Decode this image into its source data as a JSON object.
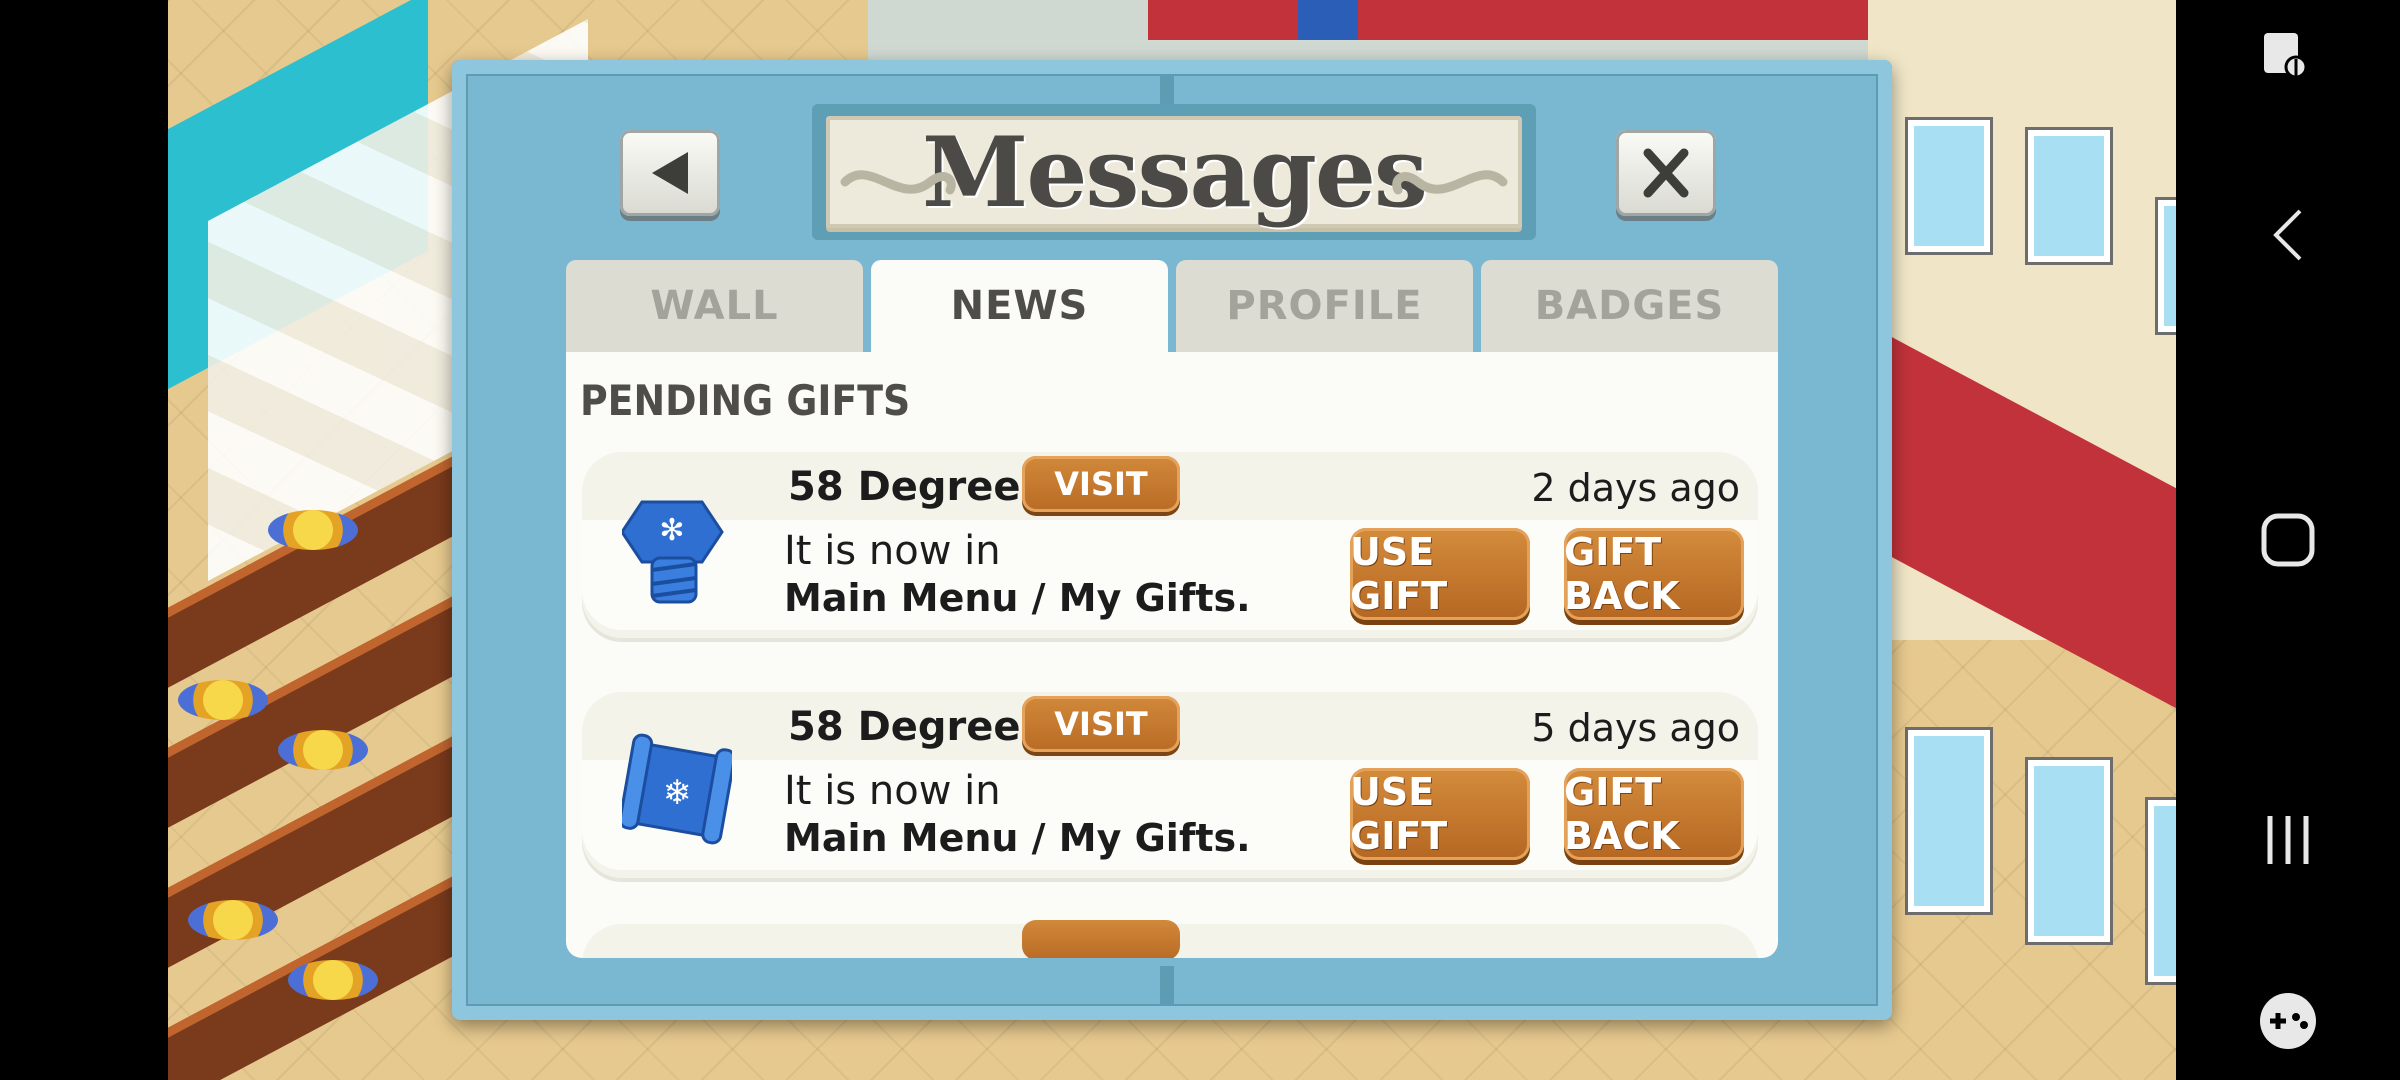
{
  "dialog": {
    "title": "Messages",
    "tabs": [
      {
        "label": "WALL",
        "active": false
      },
      {
        "label": "NEWS",
        "active": true
      },
      {
        "label": "PROFILE",
        "active": false
      },
      {
        "label": "BADGES",
        "active": false
      }
    ],
    "section_title": "PENDING GIFTS",
    "gifts": [
      {
        "sender": "58 Degrees",
        "visit_label": "VISIT",
        "time": "2 days ago",
        "message_line1": "It is now in",
        "message_line2": "Main Menu / My Gifts.",
        "use_label": "USE GIFT",
        "back_label": "GIFT BACK",
        "icon": "blue-snowflake-bolt-icon"
      },
      {
        "sender": "58 Degrees",
        "visit_label": "VISIT",
        "time": "5 days ago",
        "message_line1": "It is now in",
        "message_line2": "Main Menu / My Gifts.",
        "use_label": "USE GIFT",
        "back_label": "GIFT BACK",
        "icon": "blue-reindeer-scroll-icon"
      }
    ]
  },
  "colors": {
    "dialog_frame": "#7ab8d1",
    "button_orange": "#c07a2e",
    "tab_active": "#fbfbf7",
    "tab_inactive": "#dcdcd2"
  },
  "nav": {
    "icons": [
      "accessibility-icon",
      "back-icon",
      "home-icon",
      "recents-icon",
      "game-launcher-icon"
    ]
  }
}
